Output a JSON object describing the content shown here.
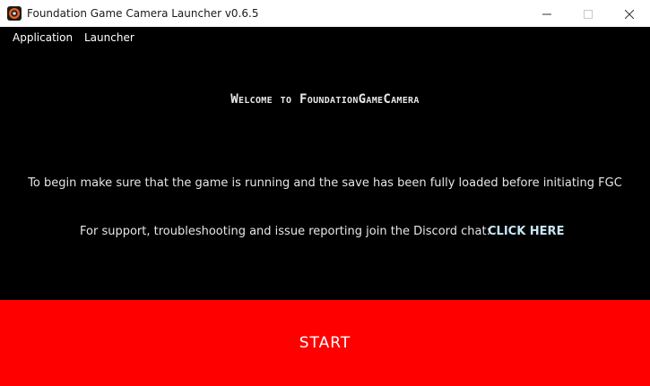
{
  "window": {
    "title": "Foundation Game Camera Launcher v0.6.5",
    "icon": "camera-lens-icon",
    "controls": {
      "minimize_icon": "minimize-icon",
      "maximize_icon": "maximize-icon",
      "close_icon": "close-icon"
    }
  },
  "menubar": {
    "items": [
      {
        "label": "Application"
      },
      {
        "label": "Launcher"
      }
    ]
  },
  "content": {
    "welcome": "Welcome to FoundationGameCamera",
    "instruction": "To begin make sure that the game is running and the save has been fully loaded before initiating FGC",
    "support_text": "For support, troubleshooting and issue reporting join the Discord chat:",
    "support_link": "CLICK HERE"
  },
  "start_button": {
    "label": "START"
  },
  "colors": {
    "background": "#000000",
    "start_button": "#ff0000",
    "link": "#c7e6f7",
    "titlebar": "#ffffff"
  }
}
